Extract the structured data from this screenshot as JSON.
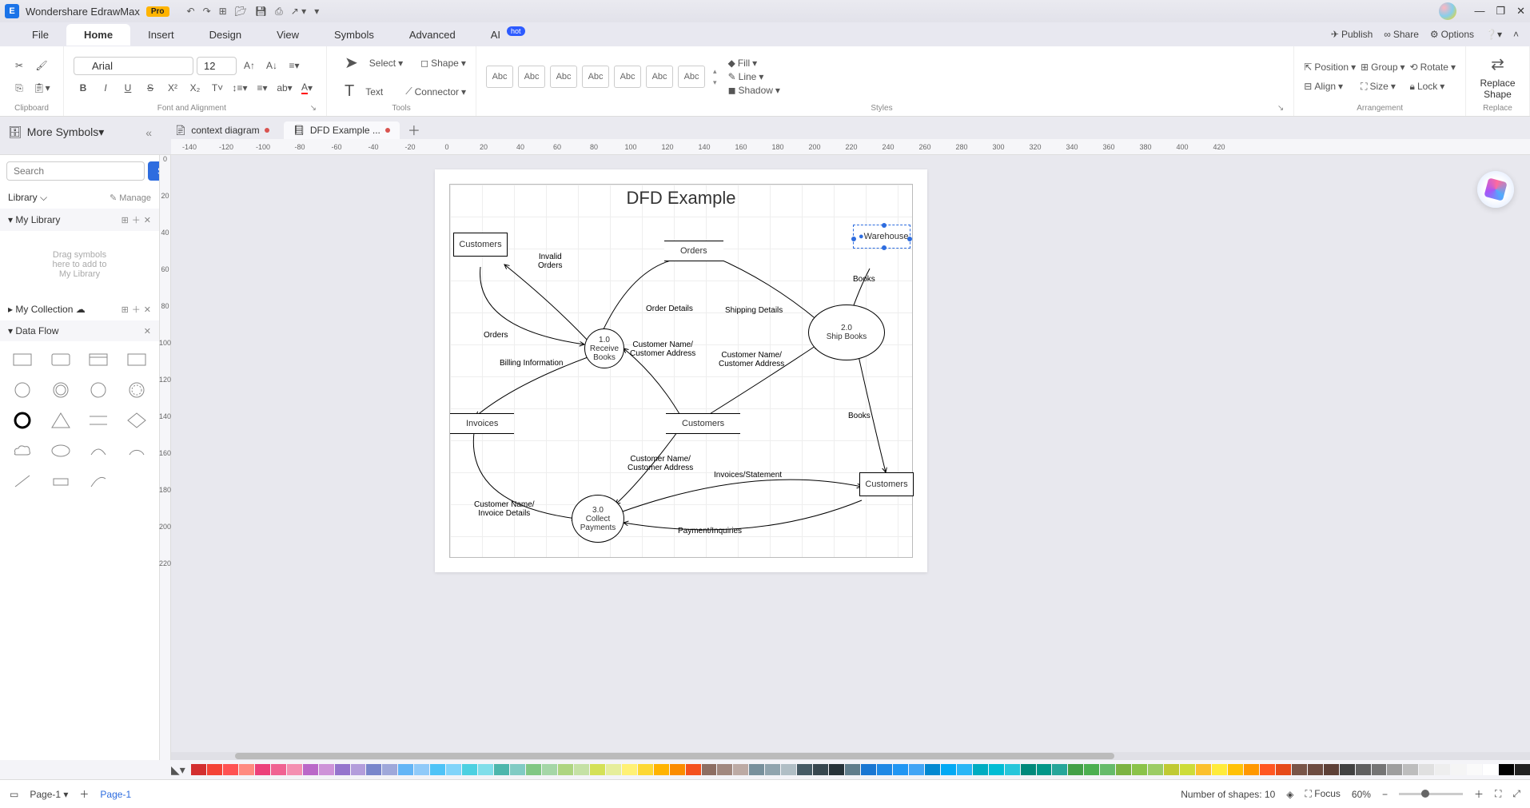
{
  "app": {
    "title": "Wondershare EdrawMax",
    "badge": "Pro"
  },
  "menus": [
    "File",
    "Home",
    "Insert",
    "Design",
    "View",
    "Symbols",
    "Advanced",
    "AI"
  ],
  "active_menu": "Home",
  "menu_right": {
    "publish": "Publish",
    "share": "Share",
    "options": "Options"
  },
  "ribbon": {
    "clipboard": "Clipboard",
    "font_alignment": "Font and Alignment",
    "tools": "Tools",
    "styles": "Styles",
    "arrangement": "Arrangement",
    "replace": "Replace",
    "font_name": "Arial",
    "font_size": "12",
    "select": "Select",
    "text": "Text",
    "shape": "Shape",
    "connector": "Connector",
    "style_cell": "Abc",
    "fill": "Fill",
    "line": "Line",
    "shadow": "Shadow",
    "position": "Position",
    "align": "Align",
    "group": "Group",
    "size": "Size",
    "rotate": "Rotate",
    "lock": "Lock",
    "replace_shape": "Replace\nShape"
  },
  "sidebar": {
    "title": "More Symbols",
    "search_placeholder": "Search",
    "search_btn": "Search",
    "library": "Library",
    "manage": "Manage",
    "my_library": "My Library",
    "drop_hint": "Drag symbols\nhere to add to\nMy Library",
    "my_collection": "My Collection",
    "data_flow": "Data Flow"
  },
  "tabs": [
    {
      "label": "context diagram",
      "dot": "#d9534f",
      "active": false
    },
    {
      "label": "DFD Example ...",
      "dot": "#d9534f",
      "active": true
    }
  ],
  "hruler": [
    "-140",
    "-120",
    "-100",
    "-80",
    "-60",
    "-40",
    "-20",
    "0",
    "20",
    "40",
    "60",
    "80",
    "100",
    "120",
    "140",
    "160",
    "180",
    "200",
    "220",
    "240",
    "260",
    "280",
    "300",
    "320",
    "340",
    "360",
    "380",
    "400",
    "420"
  ],
  "vruler": [
    "0",
    "20",
    "40",
    "60",
    "80",
    "100",
    "120",
    "140",
    "160",
    "180",
    "200",
    "220"
  ],
  "diagram": {
    "title": "DFD Example",
    "entities": {
      "customers1": "Customers",
      "warehouse": "Warehouse",
      "customers2": "Customers"
    },
    "processes": {
      "p1": {
        "num": "1.0",
        "name": "Receive\nBooks"
      },
      "p2": {
        "num": "2.0",
        "name": "Ship Books"
      },
      "p3": {
        "num": "3.0",
        "name": "Collect\nPayments"
      }
    },
    "stores": {
      "orders": "Orders",
      "invoices": "Invoices",
      "customers": "Customers"
    },
    "flows": {
      "invalid_orders": "Invalid\nOrders",
      "orders": "Orders",
      "order_details": "Order Details",
      "shipping_details": "Shipping Details",
      "books": "Books",
      "cust_name_addr": "Customer Name/\nCustomer Address",
      "billing_info": "Billing Information",
      "books2": "Books",
      "invoice_details": "Customer Name/\nInvoice Details",
      "cust_name_addr2": "Customer Name/\nCustomer Address",
      "cust_name_addr3": "Customer Name/\nCustomer Address",
      "invoices_stmt": "Invoices/Statement",
      "payment_inq": "Payment/Inquiries"
    }
  },
  "status": {
    "page_tab": "Page-1",
    "page_tab_active": "Page-1",
    "shapes": "Number of shapes: 10",
    "focus": "Focus",
    "zoom": "60%"
  },
  "colors": [
    "#d32f2f",
    "#f44336",
    "#ff5252",
    "#ff8a80",
    "#ec407a",
    "#f06292",
    "#f48fb1",
    "#ba68c8",
    "#ce93d8",
    "#9575cd",
    "#b39ddb",
    "#7986cb",
    "#9fa8da",
    "#64b5f6",
    "#90caf9",
    "#4fc3f7",
    "#81d4fa",
    "#4dd0e1",
    "#80deea",
    "#4db6ac",
    "#80cbc4",
    "#81c784",
    "#a5d6a7",
    "#aed581",
    "#c5e1a5",
    "#d4e157",
    "#e6ee9c",
    "#fff176",
    "#fdd835",
    "#ffb300",
    "#fb8c00",
    "#f4511e",
    "#8d6e63",
    "#a1887f",
    "#bcaaa4",
    "#78909c",
    "#90a4ae",
    "#b0bec5",
    "#455a64",
    "#37474f",
    "#263238",
    "#607d8b",
    "#1976d2",
    "#1e88e5",
    "#2196f3",
    "#42a5f5",
    "#0288d1",
    "#03a9f4",
    "#29b6f6",
    "#00acc1",
    "#00bcd4",
    "#26c6da",
    "#00897b",
    "#009688",
    "#26a69a",
    "#43a047",
    "#4caf50",
    "#66bb6a",
    "#7cb342",
    "#8bc34a",
    "#9ccc65",
    "#c0ca33",
    "#cddc39",
    "#fbc02d",
    "#ffeb3b",
    "#ffc107",
    "#ff9800",
    "#ff5722",
    "#e64a19",
    "#795548",
    "#6d4c41",
    "#5d4037",
    "#424242",
    "#616161",
    "#757575",
    "#9e9e9e",
    "#bdbdbd",
    "#e0e0e0",
    "#eeeeee",
    "#f5f5f5",
    "#fafafa",
    "#ffffff",
    "#000000",
    "#212121"
  ]
}
